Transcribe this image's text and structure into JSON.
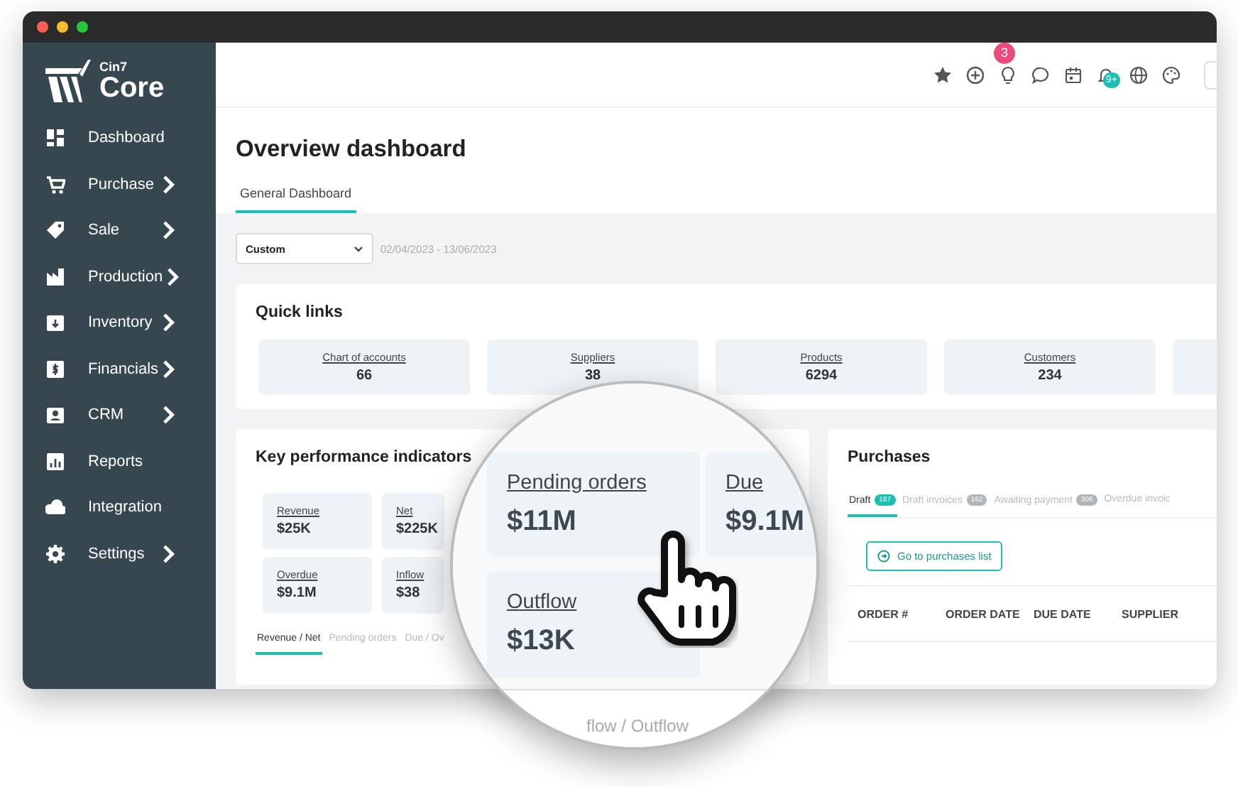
{
  "sidebar": {
    "logo": {
      "small": "Cin7",
      "large": "Core"
    },
    "items": [
      {
        "label": "Dashboard",
        "has_submenu": false
      },
      {
        "label": "Purchase",
        "has_submenu": true
      },
      {
        "label": "Sale",
        "has_submenu": true
      },
      {
        "label": "Production",
        "has_submenu": true
      },
      {
        "label": "Inventory",
        "has_submenu": true
      },
      {
        "label": "Financials",
        "has_submenu": true
      },
      {
        "label": "CRM",
        "has_submenu": true
      },
      {
        "label": "Reports",
        "has_submenu": false
      },
      {
        "label": "Integration",
        "has_submenu": false
      },
      {
        "label": "Settings",
        "has_submenu": true
      }
    ]
  },
  "toolbar": {
    "idea_badge": "3",
    "notification_badge": "9+"
  },
  "page": {
    "title": "Overview dashboard",
    "tabs": [
      {
        "label": "General Dashboard",
        "selected": true
      }
    ],
    "period_select": {
      "value": "Custom"
    },
    "date_range": "02/04/2023 - 13/06/2023"
  },
  "quick_links": {
    "title": "Quick links",
    "items": [
      {
        "label": "Chart of accounts",
        "value": "66"
      },
      {
        "label": "Suppliers",
        "value": "38"
      },
      {
        "label": "Products",
        "value": "6294"
      },
      {
        "label": "Customers",
        "value": "234"
      }
    ]
  },
  "kpi": {
    "title": "Key performance indicators",
    "cards": [
      {
        "label": "Revenue",
        "value": "$25K"
      },
      {
        "label": "Net",
        "value": "$225K"
      },
      {
        "label": "Overdue",
        "value": "$9.1M"
      },
      {
        "label": "Inflow",
        "value": "$38"
      }
    ],
    "tabs": [
      {
        "label": "Revenue / Net",
        "selected": true
      },
      {
        "label": "Pending orders",
        "selected": false
      },
      {
        "label": "Due / Ov",
        "selected": false
      }
    ]
  },
  "purchases": {
    "title": "Purchases",
    "tabs": [
      {
        "label": "Draft",
        "count": "187",
        "selected": true
      },
      {
        "label": "Draft invoices",
        "count": "162",
        "selected": false
      },
      {
        "label": "Awaiting payment",
        "count": "306",
        "selected": false
      },
      {
        "label": "Overdue invoic",
        "selected": false
      }
    ],
    "button": "Go to purchases list",
    "columns": [
      "ORDER #",
      "ORDER DATE",
      "DUE DATE",
      "SUPPLIER"
    ]
  },
  "magnifier": {
    "cards": [
      {
        "label": "Pending orders",
        "value": "$11M"
      },
      {
        "label": "Due",
        "value": "$9.1M"
      },
      {
        "label": "Outflow",
        "value": "$13K"
      }
    ],
    "caption": "flow / Outflow"
  }
}
